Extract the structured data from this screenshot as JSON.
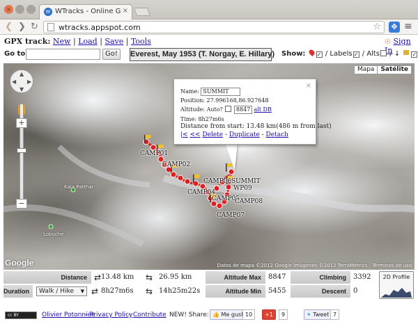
{
  "browser": {
    "tab_title": "WTracks - Online GPX track",
    "tab_favicon": "W",
    "url": "wtracks.appspot.com"
  },
  "header": {
    "app_label": "GPX track:",
    "menu": [
      "New",
      "Load",
      "Save",
      "Tools"
    ],
    "signin": "Sign In"
  },
  "search": {
    "label": "Go to:",
    "value": "",
    "button": "Go!"
  },
  "track_title": "Everest, May 1953 (T. Norgay, E. Hillary)",
  "show": {
    "label": "Show:",
    "labels": "Labels",
    "alts": "Alts",
    "sep": "/"
  },
  "map": {
    "types": [
      "Mapa",
      "Satélite"
    ],
    "attribution": "Datos de mapa ©2012 Google Imágenes ©2012 TerraMetrics · Términos de uso",
    "logo": "Google",
    "labels": [
      "CAMP01",
      "CAMP02",
      "CAMP04",
      "CAMP05",
      "CAMP06",
      "CAMP07",
      "CAMP08",
      "SUMMIT",
      "WP09"
    ],
    "poi": [
      "Kala Patthar",
      "Lobuche"
    ]
  },
  "popup": {
    "name_label": "Name:",
    "name_value": "SUMMIT",
    "position": "Position: 27.996168,86.927648",
    "altitude_label": "Altitude: Auto?",
    "altitude_value": "8847",
    "alt_db": "alt DB",
    "time": "Time: 8h27m6s",
    "distance": "Distance from start: 13.48 km(486 m from last)",
    "links": [
      "|<",
      "<<",
      "Delete",
      "Duplicate",
      "Detach"
    ]
  },
  "stats": {
    "distance_label": "Distance",
    "distance_value": "13.48 km",
    "distance_total": "26.95 km",
    "duration_label": "Duration",
    "activity": "Walk / Hike",
    "duration_value": "8h27m6s",
    "duration_total": "14h25m22s",
    "alt_max_label": "Altitude Max",
    "alt_max_value": "8847",
    "alt_min_label": "Altitude Min",
    "alt_min_value": "5455",
    "climbing_label": "Climbing",
    "climbing_value": "3392",
    "descent_label": "Descent",
    "descent_value": "0",
    "profile_button": "2D Profile"
  },
  "footer": {
    "cc": "cc BY",
    "author": "Olivier Potonniée",
    "privacy": "Privacy Policy",
    "contribute": "Contribute",
    "sep": "-",
    "newshare": "NEW! Share:",
    "fb_label": "Me gusta",
    "fb_count": "10",
    "gplus_label": "+1",
    "gplus_count": "9",
    "tweet_label": "Tweet",
    "tweet_count": "7"
  },
  "colors": {
    "track": "#d42020",
    "link": "#1a0dab"
  }
}
